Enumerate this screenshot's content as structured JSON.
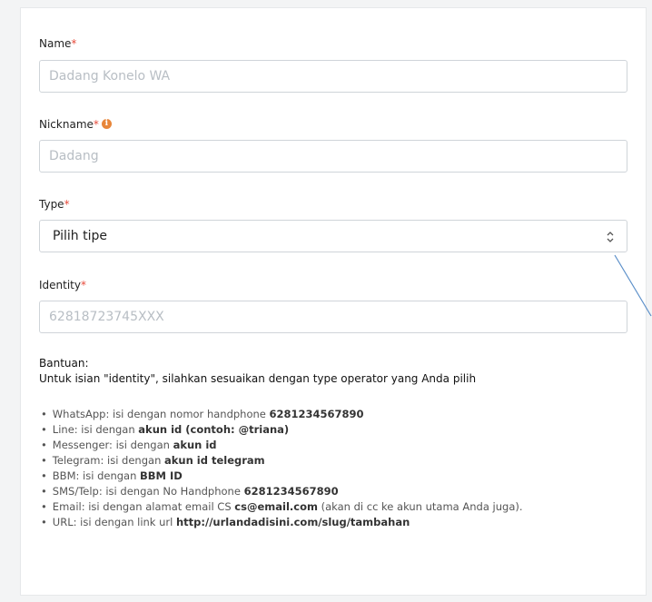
{
  "form": {
    "name": {
      "label": "Name",
      "required": "*",
      "placeholder": "Dadang Konelo WA"
    },
    "nickname": {
      "label": "Nickname",
      "required": "*",
      "info_icon": "i",
      "placeholder": "Dadang"
    },
    "type": {
      "label": "Type",
      "required": "*",
      "selected": "Pilih tipe"
    },
    "identity": {
      "label": "Identity",
      "required": "*",
      "placeholder": "62818723745XXX"
    }
  },
  "help": {
    "title": "Bantuan:",
    "subtitle": "Untuk isian \"identity\", silahkan sesuaikan dengan type operator yang Anda pilih",
    "items": [
      {
        "text": "WhatsApp: isi dengan nomor handphone ",
        "bold": "6281234567890",
        "suffix": ""
      },
      {
        "text": "Line: isi dengan ",
        "bold": "akun id (contoh: @triana)",
        "suffix": ""
      },
      {
        "text": "Messenger: isi dengan ",
        "bold": "akun id",
        "suffix": ""
      },
      {
        "text": "Telegram: isi dengan ",
        "bold": "akun id telegram",
        "suffix": ""
      },
      {
        "text": "BBM: isi dengan ",
        "bold": "BBM ID",
        "suffix": ""
      },
      {
        "text": "SMS/Telp: isi dengan No Handphone ",
        "bold": "6281234567890",
        "suffix": ""
      },
      {
        "text": "Email: isi dengan alamat email CS ",
        "bold": "cs@email.com",
        "suffix": " (akan di cc ke akun utama Anda juga)."
      },
      {
        "text": "URL: isi dengan link url ",
        "bold": "http://urlandadisini.com/slug/tambahan",
        "suffix": ""
      }
    ]
  },
  "colors": {
    "required": "#e74c3c",
    "info_icon": "#e8863a",
    "annotation_line": "#5b8fc9"
  },
  "icons": {
    "info": "info-circle-icon",
    "select_arrows": "select-arrows-icon"
  }
}
